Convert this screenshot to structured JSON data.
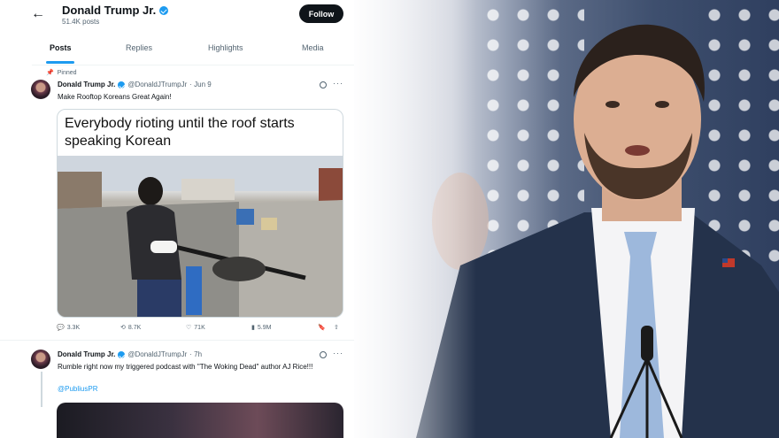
{
  "header": {
    "back_icon": "arrow-left-icon",
    "name": "Donald Trump Jr.",
    "posts_count": "51.4K posts",
    "follow_label": "Follow"
  },
  "tabs": [
    {
      "label": "Posts",
      "active": true
    },
    {
      "label": "Replies",
      "active": false
    },
    {
      "label": "Highlights",
      "active": false
    },
    {
      "label": "Media",
      "active": false
    }
  ],
  "pinned_label": "Pinned",
  "tweets": [
    {
      "name": "Donald Trump Jr.",
      "handle": "@DonaldJTrumpJr",
      "date": "· Jun 9",
      "text": "Make Rooftop Koreans Great Again!",
      "card_caption": "Everybody rioting until the roof starts speaking Korean",
      "stats": {
        "replies": "3.3K",
        "reposts": "8.7K",
        "likes": "71K",
        "views": "5.9M"
      }
    },
    {
      "name": "Donald Trump Jr.",
      "handle": "@DonaldJTrumpJr",
      "date": "· 7h",
      "text": "Rumble right now my triggered podcast with \"The Woking Dead\" author AJ Rice!!!",
      "mention": "@PubliusPR"
    }
  ],
  "colors": {
    "accent": "#1d9bf0",
    "text": "#0f1419",
    "muted": "#536471"
  }
}
